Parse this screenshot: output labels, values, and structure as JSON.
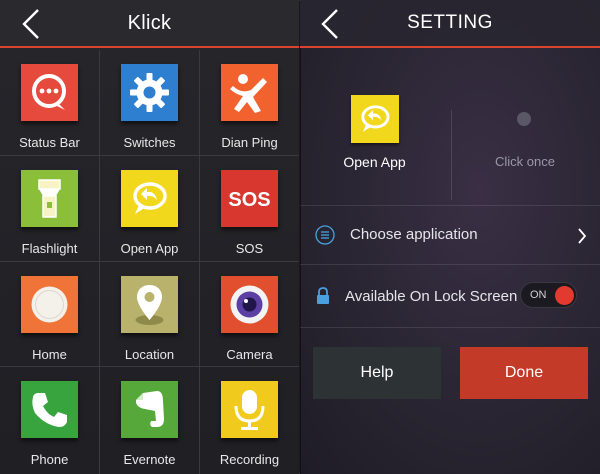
{
  "colors": {
    "accent_red": "#d9442e",
    "yellow": "#f1d81c",
    "done_red": "#c43a28",
    "help_bg": "#2d3334"
  },
  "left_panel": {
    "title": "Klick",
    "back_icon": "chevron-left-icon",
    "apps": [
      {
        "label": "Status Bar",
        "icon": "chat-dots-icon",
        "color": "#e54a3c"
      },
      {
        "label": "Switches",
        "icon": "gear-icon",
        "color": "#2f7fd0"
      },
      {
        "label": "Dian Ping",
        "icon": "person-mascot-icon",
        "color": "#f2622e"
      },
      {
        "label": "Flashlight",
        "icon": "flashlight-icon",
        "color": "#8bbf3a"
      },
      {
        "label": "Open App",
        "icon": "reply-bubble-icon",
        "color": "#f1d81c"
      },
      {
        "label": "SOS",
        "icon": "sos-icon",
        "color": "#d7372e"
      },
      {
        "label": "Home",
        "icon": "home-button-icon",
        "color": "#f07438"
      },
      {
        "label": "Location",
        "icon": "map-pin-icon",
        "color": "#b9b26c"
      },
      {
        "label": "Camera",
        "icon": "camera-lens-icon",
        "color": "#e24f2f"
      },
      {
        "label": "Phone",
        "icon": "phone-icon",
        "color": "#37a43e"
      },
      {
        "label": "Evernote",
        "icon": "evernote-icon",
        "color": "#57a83a"
      },
      {
        "label": "Recording",
        "icon": "microphone-icon",
        "color": "#f0cb1d"
      }
    ]
  },
  "right_panel": {
    "title": "SETTING",
    "back_icon": "chevron-left-icon",
    "selected_app_label": "Open App",
    "gesture_label": "Click once",
    "choose_application_label": "Choose application",
    "lock_screen_label": "Available On Lock Screen",
    "toggle_state_label": "ON",
    "help_label": "Help",
    "done_label": "Done"
  }
}
